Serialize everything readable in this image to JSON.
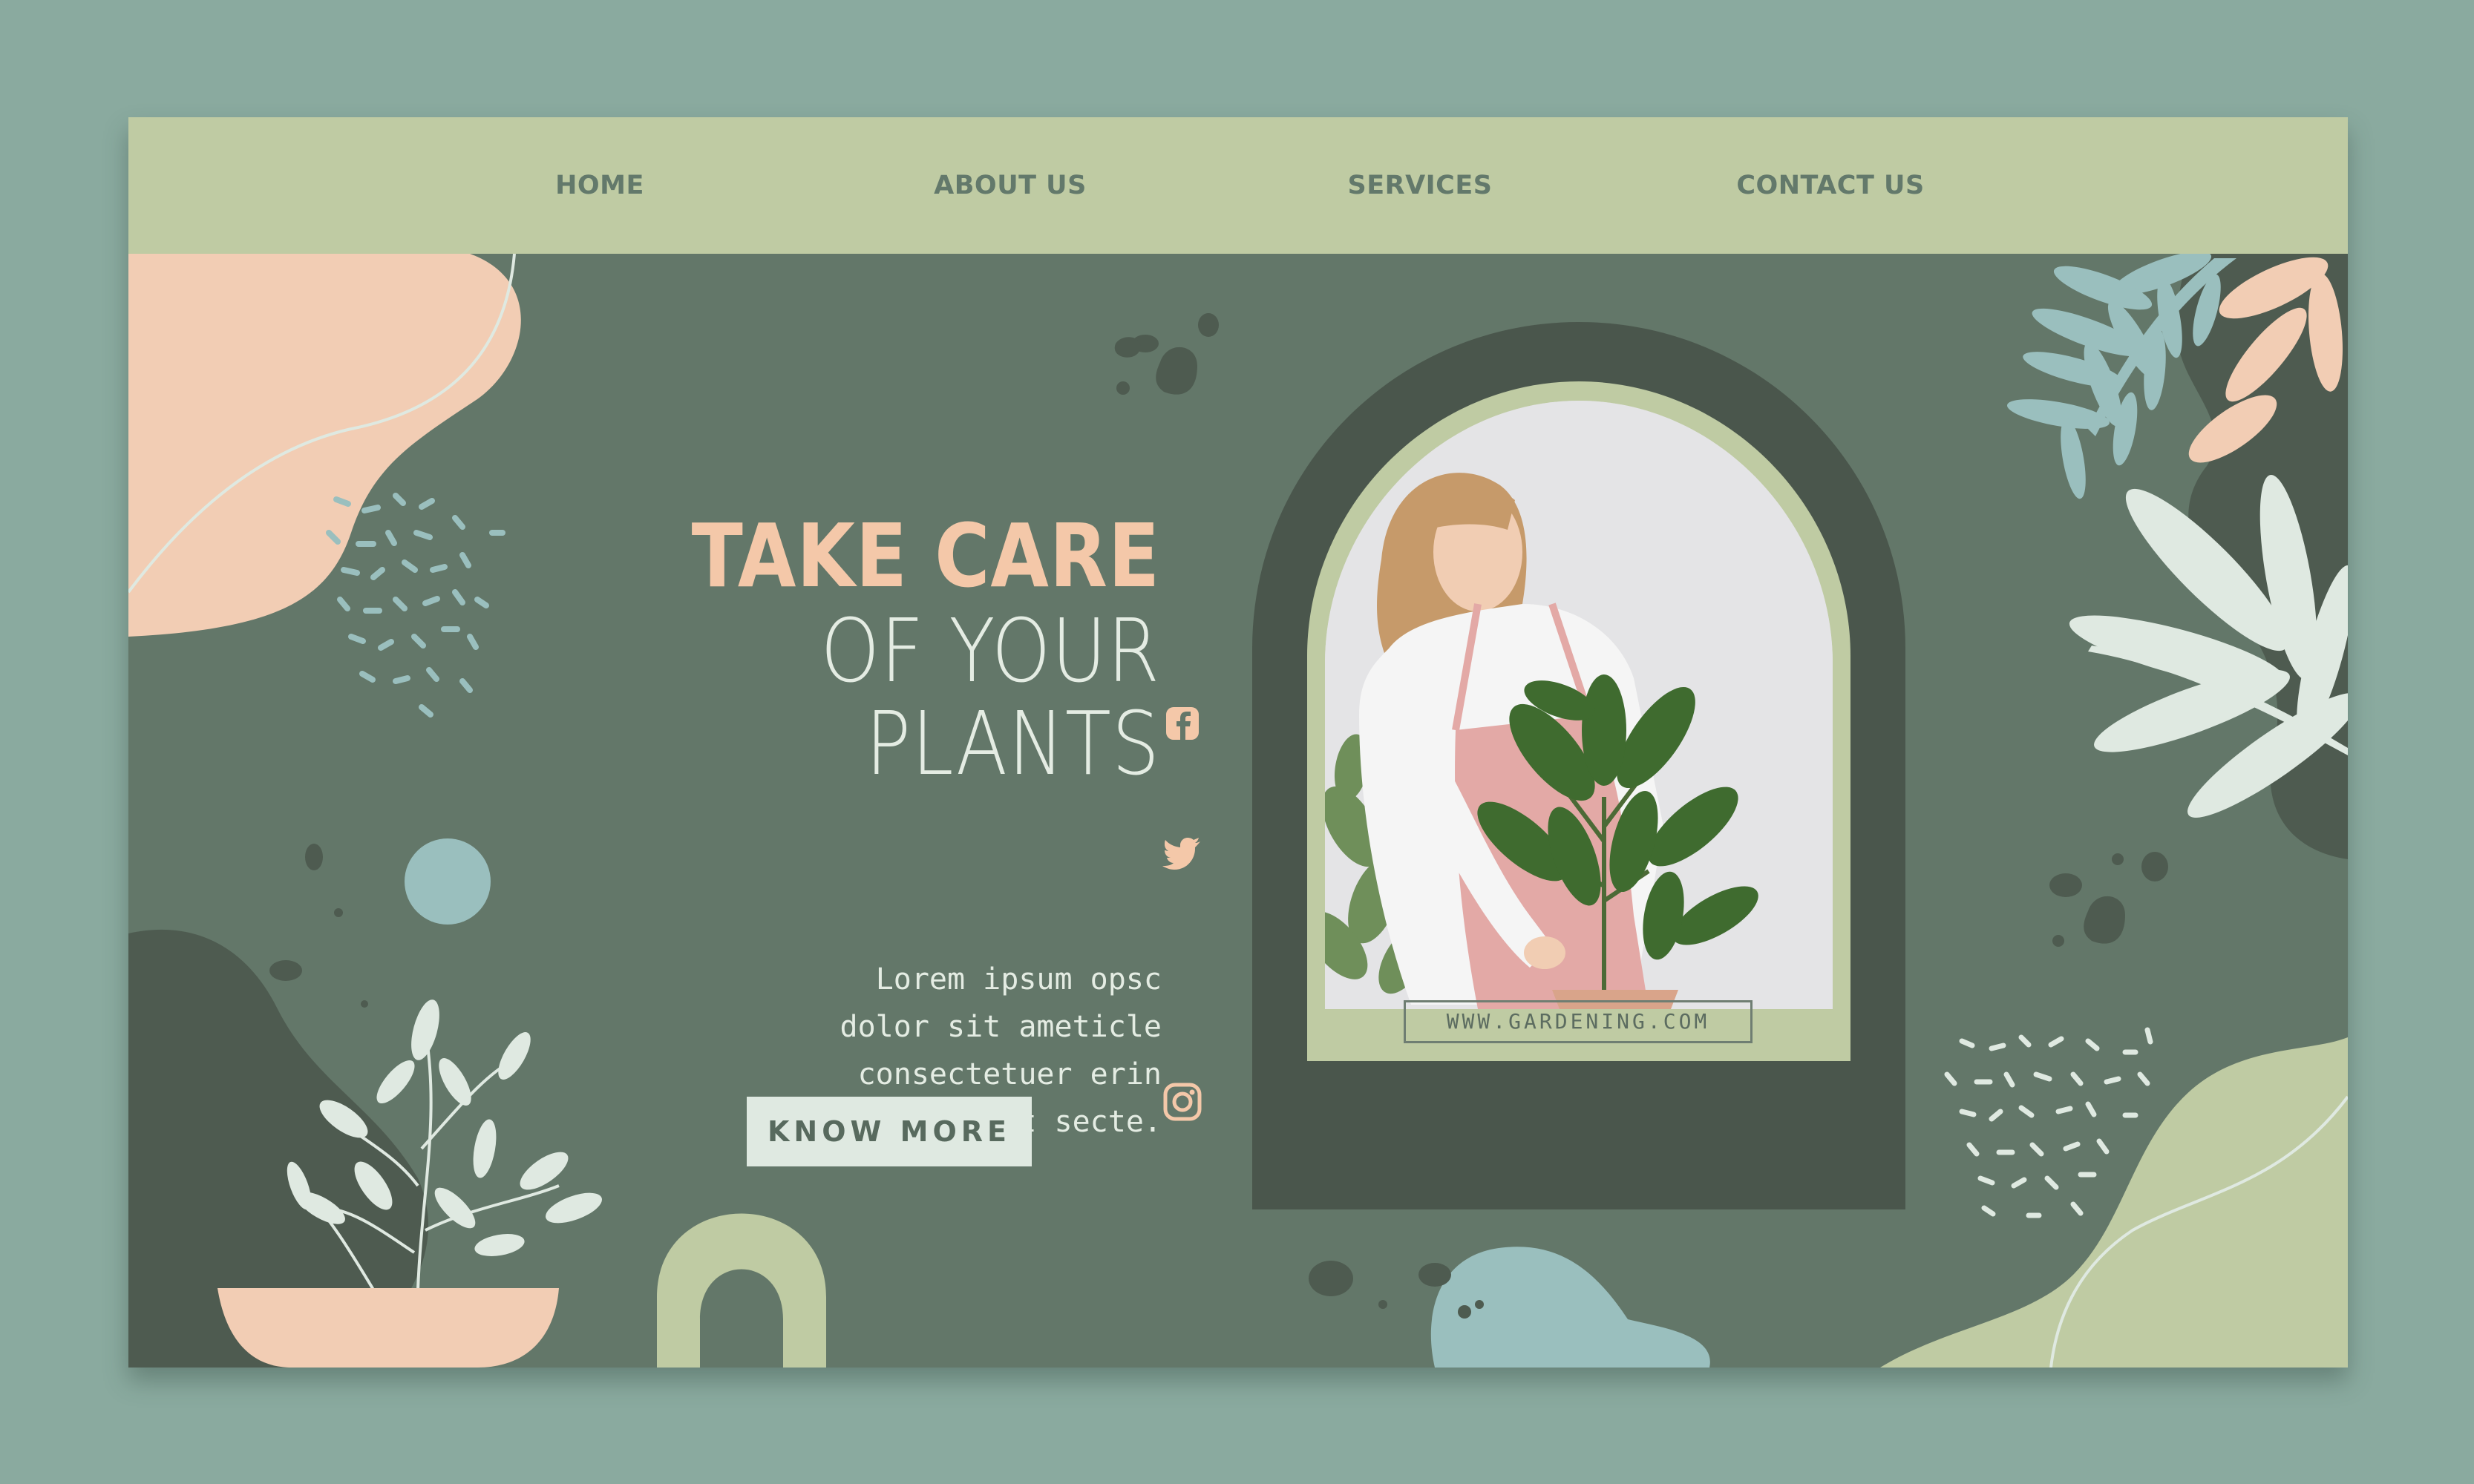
{
  "nav": {
    "items": [
      "HOME",
      "ABOUT US",
      "SERVICES",
      "CONTACT US"
    ]
  },
  "hero": {
    "headline_line1": "TAKE CARE",
    "headline_line2": "OF YOUR",
    "headline_line3": "PLANTS",
    "body_lines": [
      "Lorem ipsum opsc",
      "dolor sit ameticle",
      "consectetuer erin",
      "lor st amet secte."
    ],
    "cta_label": "KNOW MORE"
  },
  "photo": {
    "caption_url": "WWW.GARDENING.COM"
  },
  "social": {
    "icons": [
      "facebook-icon",
      "twitter-icon",
      "instagram-icon"
    ]
  },
  "colors": {
    "page_background": "#8aaa9f",
    "card_background": "#637769",
    "navbar": "#bfcba3",
    "nav_text": "#63796b",
    "accent_peach": "#f4c8a9",
    "accent_blue": "#9abfbe",
    "accent_sage": "#bfcba3",
    "dark_green": "#4a564c",
    "light_mint": "#dfe9e1"
  }
}
